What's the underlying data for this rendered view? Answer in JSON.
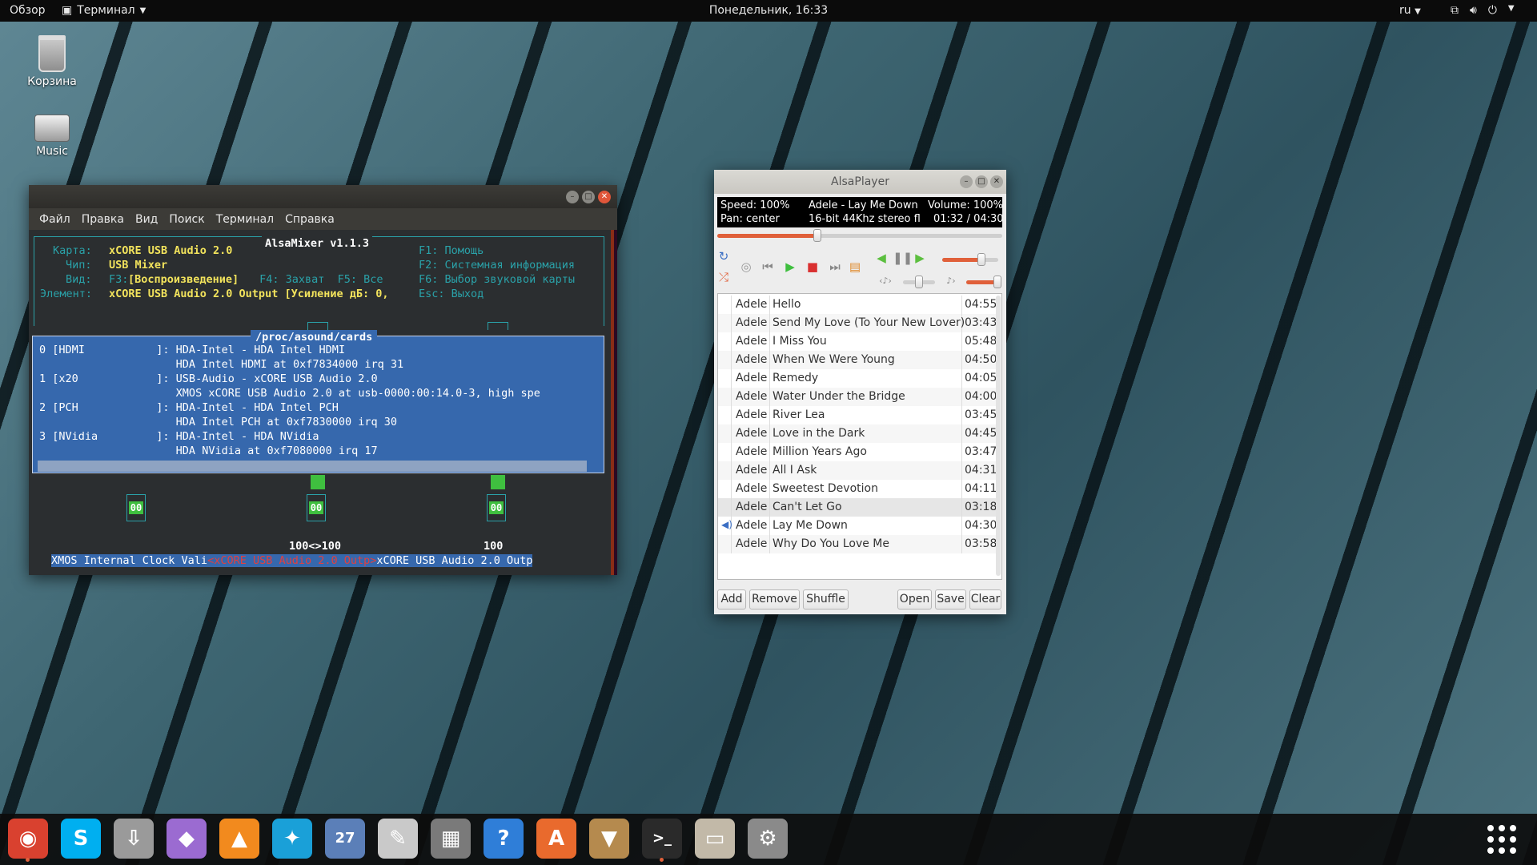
{
  "topbar": {
    "activities": "Обзор",
    "app_menu": "Терминал",
    "clock": "Понедельник, 16:33",
    "lang": "ru",
    "tray_icons": [
      "network-icon",
      "volume-icon",
      "power-icon"
    ]
  },
  "desktop": {
    "trash_label": "Корзина",
    "music_label": "Music"
  },
  "terminal": {
    "menu": [
      "Файл",
      "Правка",
      "Вид",
      "Поиск",
      "Терминал",
      "Справка"
    ],
    "alsamixer": {
      "title": "AlsaMixer v1.1.3",
      "card_label": "Карта:",
      "card_value": "xCORE USB Audio 2.0",
      "chip_label": "Чип:",
      "chip_value": "USB Mixer",
      "view_label": "Вид:",
      "view_f3": "F3:",
      "view_value": "[Воспроизведение]",
      "view_f4": " F4: Захват  F5: Все",
      "element_label": "Элемент:",
      "element_value": "xCORE USB Audio 2.0 Output [Усиление дБ: 0,",
      "help_f1": "F1: Помощь",
      "help_f2": "F2: Системная информация",
      "help_f6": "F6: Выбор звуковой карты",
      "help_esc": "Esc: Выход"
    },
    "cards_dialog": {
      "title": "/proc/asound/cards",
      "lines": [
        "0 [HDMI           ]: HDA-Intel - HDA Intel HDMI",
        "                     HDA Intel HDMI at 0xf7834000 irq 31",
        "1 [x20            ]: USB-Audio - xCORE USB Audio 2.0",
        "                     XMOS xCORE USB Audio 2.0 at usb-0000:00:14.0-3, high spe",
        "2 [PCH            ]: HDA-Intel - HDA Intel PCH",
        "                     HDA Intel PCH at 0xf7830000 irq 30",
        "3 [NVidia         ]: HDA-Intel - HDA NVidia",
        "                     HDA NVidia at 0xf7080000 irq 17"
      ]
    },
    "meters": [
      "00",
      "00",
      "00"
    ],
    "level_center": "100<>100",
    "level_right": "100",
    "controls": {
      "a": "XMOS Internal Clock Vali",
      "b": "<xCORE USB Audio 2.0 Outp>",
      "c": "xCORE USB Audio 2.0 Outp"
    }
  },
  "alsaplayer": {
    "title": "AlsaPlayer",
    "speed": "Speed: 100%",
    "track": "Adele - Lay Me Down",
    "volume": "Volume: 100%",
    "pan": "Pan: center",
    "format": "16-bit 44Khz stereo fl",
    "time": "01:32 / 04:30",
    "seek_fraction": 0.35,
    "volume_fraction": 0.7,
    "pan_fraction": 0.5,
    "playlist": [
      {
        "artist": "Adele",
        "title": "Hello",
        "duration": "04:55"
      },
      {
        "artist": "Adele",
        "title": "Send My Love (To Your New Lover)",
        "duration": "03:43"
      },
      {
        "artist": "Adele",
        "title": "I Miss You",
        "duration": "05:48"
      },
      {
        "artist": "Adele",
        "title": "When We Were Young",
        "duration": "04:50"
      },
      {
        "artist": "Adele",
        "title": "Remedy",
        "duration": "04:05"
      },
      {
        "artist": "Adele",
        "title": "Water Under the Bridge",
        "duration": "04:00"
      },
      {
        "artist": "Adele",
        "title": "River Lea",
        "duration": "03:45"
      },
      {
        "artist": "Adele",
        "title": "Love in the Dark",
        "duration": "04:45"
      },
      {
        "artist": "Adele",
        "title": "Million Years Ago",
        "duration": "03:47"
      },
      {
        "artist": "Adele",
        "title": "All I Ask",
        "duration": "04:31"
      },
      {
        "artist": "Adele",
        "title": "Sweetest Devotion",
        "duration": "04:11"
      },
      {
        "artist": "Adele",
        "title": "Can't Let Go",
        "duration": "03:18"
      },
      {
        "artist": "Adele",
        "title": "Lay Me Down",
        "duration": "04:30"
      },
      {
        "artist": "Adele",
        "title": "Why Do You Love Me",
        "duration": "03:58"
      }
    ],
    "selected_index": 11,
    "playing_index": 12,
    "buttons": {
      "add": "Add",
      "remove": "Remove",
      "shuffle": "Shuffle",
      "open": "Open",
      "save": "Save",
      "clear": "Clear"
    }
  },
  "dock": {
    "items": [
      {
        "name": "chrome-icon",
        "glyph": "◉",
        "color": "#d9412f"
      },
      {
        "name": "skype-icon",
        "glyph": "S",
        "color": "#00aff0"
      },
      {
        "name": "installer-icon",
        "glyph": "⇩",
        "color": "#9a9a9a"
      },
      {
        "name": "gem-icon",
        "glyph": "◆",
        "color": "#9b6bd1"
      },
      {
        "name": "vlc-icon",
        "glyph": "▲",
        "color": "#f28a1e"
      },
      {
        "name": "kodi-icon",
        "glyph": "✦",
        "color": "#1aa0d8"
      },
      {
        "name": "calendar-icon",
        "glyph": "27",
        "color": "#5b7fb8"
      },
      {
        "name": "text-editor-icon",
        "glyph": "✎",
        "color": "#c9c9c9"
      },
      {
        "name": "calculator-icon",
        "glyph": "▦",
        "color": "#7a7a7a"
      },
      {
        "name": "help-icon",
        "glyph": "?",
        "color": "#2f7ed8"
      },
      {
        "name": "software-center-icon",
        "glyph": "A",
        "color": "#e96a2d"
      },
      {
        "name": "archive-manager-icon",
        "glyph": "▼",
        "color": "#b58a4e"
      },
      {
        "name": "terminal-icon",
        "glyph": ">_",
        "color": "#2a2a2a"
      },
      {
        "name": "file-manager-icon",
        "glyph": "▭",
        "color": "#c2b9a8"
      },
      {
        "name": "settings-icon",
        "glyph": "⚙",
        "color": "#8a8a8a"
      }
    ],
    "running_indices": [
      0,
      12
    ]
  },
  "colors": {
    "accent": "#e0603a",
    "terminal_bg": "#2b2e30",
    "dialog_bg": "#3668ad"
  }
}
